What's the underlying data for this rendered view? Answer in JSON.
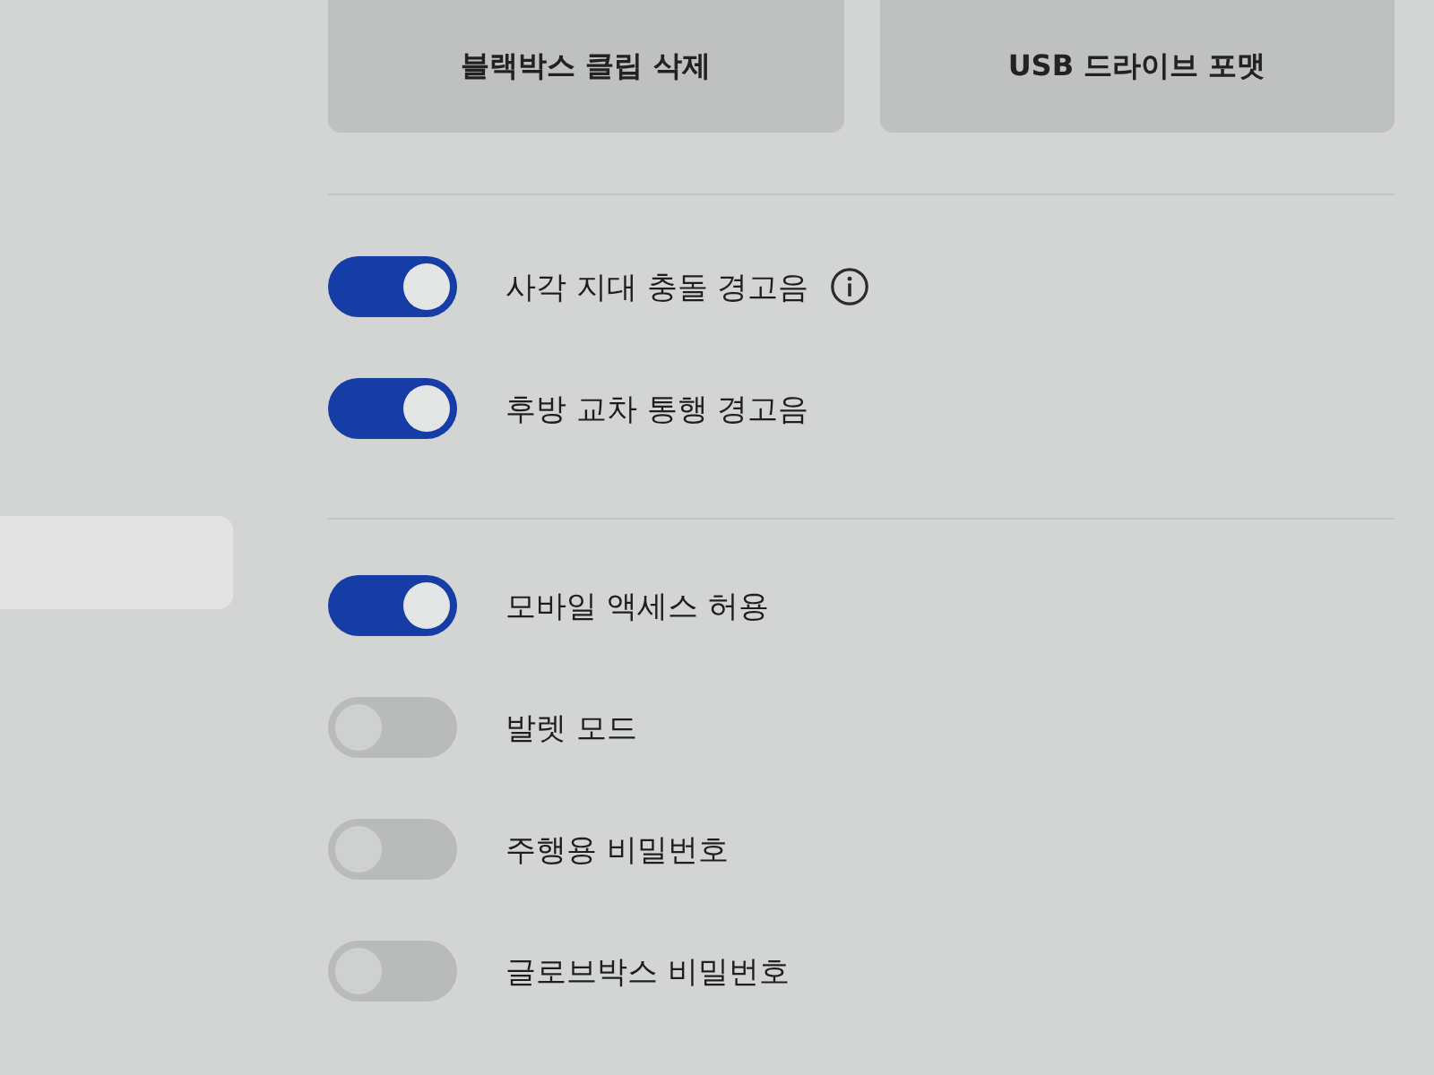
{
  "sidebar": {
    "items": [
      {
        "selected": true
      }
    ]
  },
  "buttons": [
    {
      "label": "블랙박스 클립 삭제"
    },
    {
      "label": "USB 드라이브 포맷"
    }
  ],
  "sections": [
    {
      "toggles": [
        {
          "label": "사각 지대 충돌 경고음",
          "on": true,
          "info": true
        },
        {
          "label": "후방 교차 통행 경고음",
          "on": true,
          "info": false
        }
      ]
    },
    {
      "toggles": [
        {
          "label": "모바일 액세스 허용",
          "on": true,
          "info": false
        },
        {
          "label": "발렛 모드",
          "on": false,
          "info": false
        },
        {
          "label": "주행용 비밀번호",
          "on": false,
          "info": false
        },
        {
          "label": "글로브박스 비밀번호",
          "on": false,
          "info": false
        }
      ]
    }
  ]
}
